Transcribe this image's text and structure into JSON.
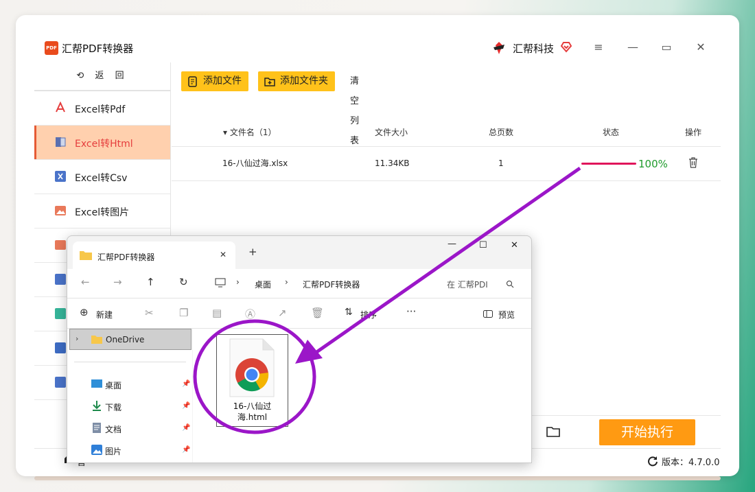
{
  "app": {
    "logo_text": "PDF",
    "title": "汇帮PDF转换器",
    "brand": "汇帮科技",
    "accent": "#ff9a12",
    "active_bg": "#ffd0ae"
  },
  "window_controls": {
    "menu": "≡",
    "minimize": "—",
    "maximize": "▭",
    "close": "✕"
  },
  "sidebar": {
    "back": "⟲ 返 回",
    "items": [
      {
        "label": "Excel转Pdf",
        "icon": "pdf-icon",
        "active": false
      },
      {
        "label": "Excel转Html",
        "icon": "html-icon",
        "active": true
      },
      {
        "label": "Excel转Csv",
        "icon": "excel-icon",
        "active": false
      },
      {
        "label": "Excel转图片",
        "icon": "image-icon",
        "active": false
      }
    ]
  },
  "toolbar": {
    "add_file": "添加文件",
    "add_folder": "添加文件夹",
    "clear": "清空列表"
  },
  "table": {
    "headers": {
      "name": "▾ 文件名（1）",
      "size": "文件大小",
      "pages": "总页数",
      "status": "状态",
      "action": "操作"
    },
    "rows": [
      {
        "name": "16-八仙过海.xlsx",
        "size": "11.34KB",
        "pages": "1",
        "progress": 1.0,
        "percent": "100%"
      }
    ]
  },
  "bottom": {
    "start": "开始执行",
    "home": "官",
    "version": "版本：4.7.0.0"
  },
  "explorer": {
    "tab_title": "汇帮PDF转换器",
    "tab_close": "✕",
    "tab_add": "+",
    "controls": {
      "minimize": "—",
      "maximize": "☐",
      "close": "✕"
    },
    "path": [
      "桌面",
      "汇帮PDF转换器"
    ],
    "search_placeholder": "在 汇帮PDI",
    "new": "新建",
    "sort": "排序",
    "more": "···",
    "preview": "预览",
    "nav": {
      "onedrive": "OneDrive",
      "items": [
        "桌面",
        "下载",
        "文档",
        "图片"
      ]
    },
    "file": {
      "name": "16-八仙过海.html"
    }
  }
}
